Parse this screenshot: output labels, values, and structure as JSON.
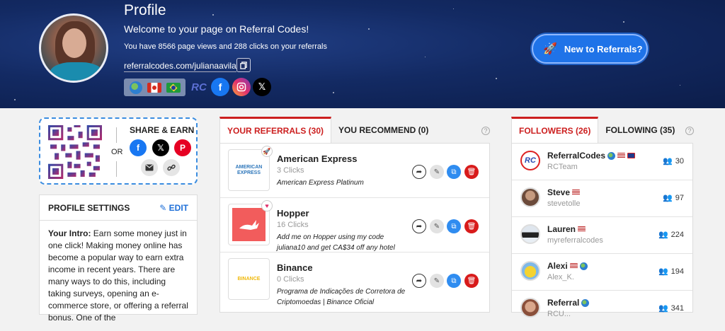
{
  "header": {
    "title": "Profile",
    "welcome": "Welcome to your page on Referral Codes!",
    "stats": "You have 8566 page views and 288 clicks on your referrals",
    "profile_url": "referralcodes.com/julianaavila",
    "cta_label": "New to Referrals?"
  },
  "share_card": {
    "title": "SHARE & EARN",
    "or_label": "OR"
  },
  "profile_settings": {
    "title": "PROFILE SETTINGS",
    "edit_label": "EDIT",
    "intro_label": "Your Intro:",
    "intro_text": "Earn some money just in one click! Making money online has become a popular way to earn extra income in recent years. There are many ways to do this, including taking surveys, opening an e-commerce store, or offering a referral bonus. One of the"
  },
  "referral_tabs": {
    "active": "YOUR REFERRALS (30)",
    "inactive": "YOU RECOMMEND (0)",
    "help": "?"
  },
  "referrals": [
    {
      "name": "American Express",
      "clicks": "3 Clicks",
      "description": "American Express Platinum",
      "logo_text": "AMERICAN EXPRESS"
    },
    {
      "name": "Hopper",
      "clicks": "16 Clicks",
      "description": "Add me on Hopper using my code juliana10 and get CA$34 off any hotel",
      "logo_text": ""
    },
    {
      "name": "Binance",
      "clicks": "0 Clicks",
      "description": "Programa de Indicações de Corretora de Criptomoedas | Binance Oficial",
      "logo_text": "BINANCE"
    }
  ],
  "follower_tabs": {
    "active": "FOLLOWERS (26)",
    "inactive": "FOLLOWING (35)",
    "help": "?"
  },
  "followers": [
    {
      "name": "ReferralCodes",
      "username": "RCTeam",
      "count": "30"
    },
    {
      "name": "Steve",
      "username": "stevetolle",
      "count": "97"
    },
    {
      "name": "Lauren",
      "username": "myreferralcodes",
      "count": "224"
    },
    {
      "name": "Alexi",
      "username": "Alex_K.",
      "count": "194"
    },
    {
      "name": "Referral",
      "username": "RCU...",
      "count": "341"
    }
  ],
  "colors": {
    "accent_red": "#cc1f1f",
    "accent_blue": "#1f73e8",
    "hero_bg": "#132a63"
  }
}
